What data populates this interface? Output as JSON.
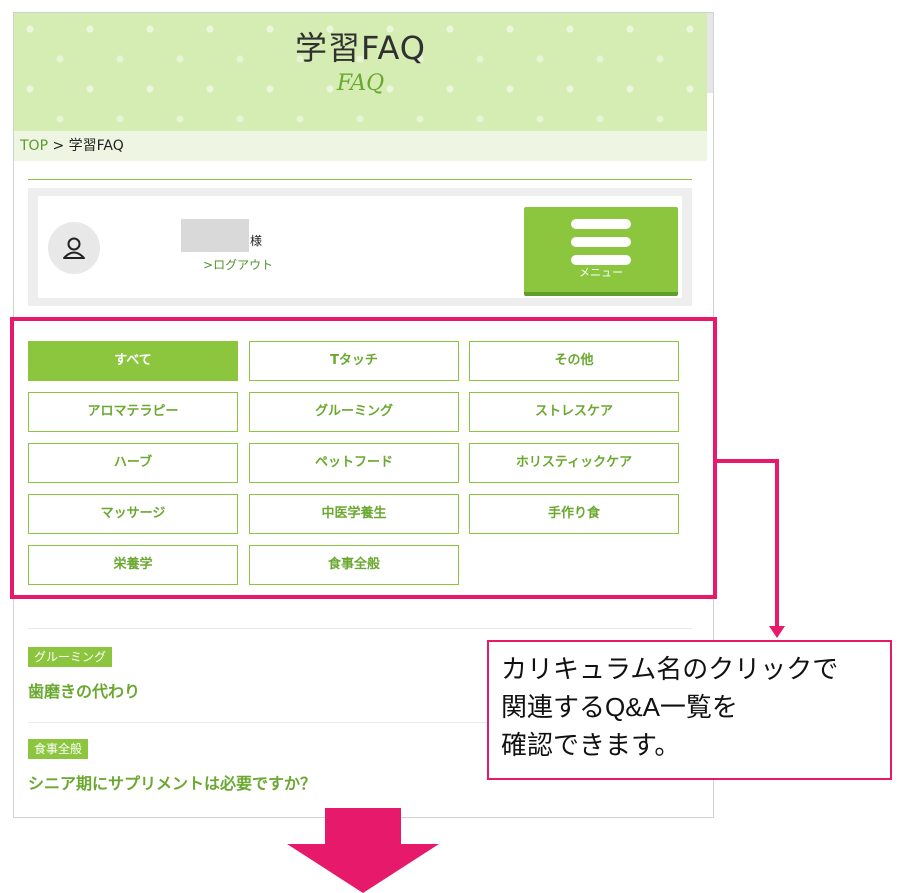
{
  "header": {
    "title": "学習FAQ",
    "subtitle": "FAQ"
  },
  "breadcrumb": {
    "top_label": "TOP",
    "separator": ">",
    "current": "学習FAQ"
  },
  "user": {
    "honorific": "様",
    "logout_label": "ログアウト",
    "logout_prefix": ">"
  },
  "menu": {
    "label": "メニュー"
  },
  "categories": [
    {
      "label": "すべて",
      "active": true
    },
    {
      "label": "Tタッチ",
      "active": false
    },
    {
      "label": "その他",
      "active": false
    },
    {
      "label": "アロマテラピー",
      "active": false
    },
    {
      "label": "グルーミング",
      "active": false
    },
    {
      "label": "ストレスケア",
      "active": false
    },
    {
      "label": "ハーブ",
      "active": false
    },
    {
      "label": "ペットフード",
      "active": false
    },
    {
      "label": "ホリスティックケア",
      "active": false
    },
    {
      "label": "マッサージ",
      "active": false
    },
    {
      "label": "中医学養生",
      "active": false
    },
    {
      "label": "手作り食",
      "active": false
    },
    {
      "label": "栄養学",
      "active": false
    },
    {
      "label": "食事全般",
      "active": false
    }
  ],
  "faqs": [
    {
      "tag": "グルーミング",
      "question": "歯磨きの代わり"
    },
    {
      "tag": "食事全般",
      "question": "シニア期にサプリメントは必要ですか？"
    }
  ],
  "callout": {
    "lines": [
      "カリキュラム名のクリックで",
      "関連するQ&A一覧を",
      "確認できます。"
    ]
  },
  "colors": {
    "brand_green": "#8cc63f",
    "header_bg": "#d5ecb3",
    "annotation_pink": "#e6196b"
  }
}
